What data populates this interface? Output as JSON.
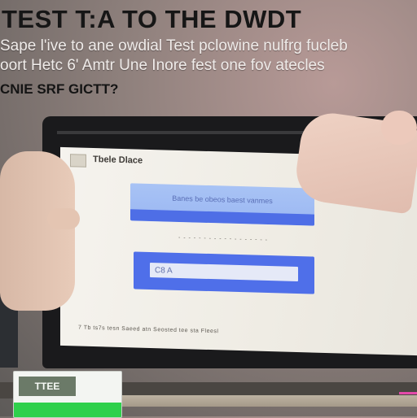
{
  "overlay": {
    "headline": "TEST T:A TO THE DWDT",
    "line1": "Sape l'ive to ane owdial Test pclowine nulfrg fucleb",
    "line2": "oort Hetc 6' Amtr Une Inore fest one fov atecles",
    "line3": "CNIE SRF GICTT?"
  },
  "laptop": {
    "app_title": "Tbele Dlace",
    "banner_text": "Banes be obeos baest vanmes",
    "divider_caption": "- - - - - - - - - - - - - - - - - -",
    "field_value": "C8 A",
    "footer_text": "7  Tb  ts7s tesn  Saeed  atn  Seosted  tee  sta  Fleesl"
  },
  "phone": {
    "screen_text": "TTEE"
  },
  "colors": {
    "accent_blue": "#4f6fe9",
    "banner_blue": "#a8c3f5",
    "phone_green": "#2fd04c"
  }
}
